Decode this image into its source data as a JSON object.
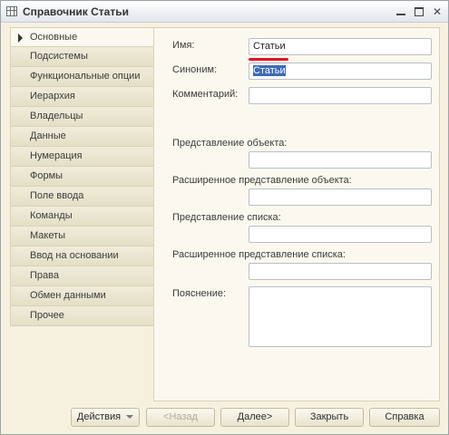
{
  "window": {
    "title": "Справочник Статьи"
  },
  "tabs": [
    {
      "label": "Основные",
      "active": true
    },
    {
      "label": "Подсистемы"
    },
    {
      "label": "Функциональные опции"
    },
    {
      "label": "Иерархия"
    },
    {
      "label": "Владельцы"
    },
    {
      "label": "Данные"
    },
    {
      "label": "Нумерация"
    },
    {
      "label": "Формы"
    },
    {
      "label": "Поле ввода"
    },
    {
      "label": "Команды"
    },
    {
      "label": "Макеты"
    },
    {
      "label": "Ввод на основании"
    },
    {
      "label": "Права"
    },
    {
      "label": "Обмен данными"
    },
    {
      "label": "Прочее"
    }
  ],
  "form": {
    "name_label": "Имя:",
    "name_value": "Статьи",
    "synonym_label": "Синоним:",
    "synonym_value": "Статьи",
    "comment_label": "Комментарий:",
    "comment_value": "",
    "object_repr_label": "Представление объекта:",
    "object_repr_value": "",
    "ext_object_repr_label": "Расширенное представление объекта:",
    "ext_object_repr_value": "",
    "list_repr_label": "Представление списка:",
    "list_repr_value": "",
    "ext_list_repr_label": "Расширенное представление списка:",
    "ext_list_repr_value": "",
    "explanation_label": "Пояснение:",
    "explanation_value": ""
  },
  "buttons": {
    "actions": "Действия",
    "back": "<Назад",
    "next": "Далее>",
    "close": "Закрыть",
    "help": "Справка"
  },
  "colors": {
    "accent_underline": "#e3122a",
    "selection": "#3d6bb6"
  }
}
